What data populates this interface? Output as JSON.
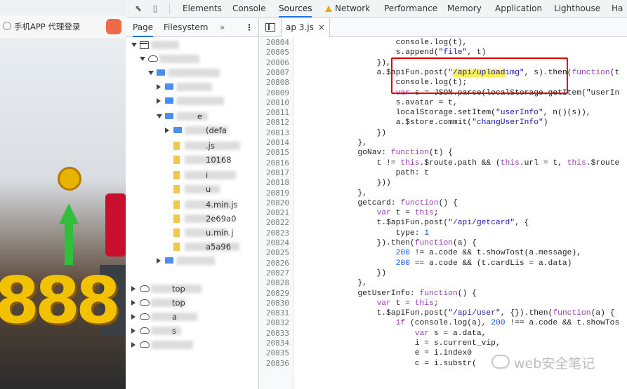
{
  "left_page": {
    "header_text": "手机APP 代理登录"
  },
  "devtools": {
    "tabs": [
      "Elements",
      "Console",
      "Sources",
      "Network",
      "Performance",
      "Memory",
      "Application",
      "Lighthouse",
      "Ha"
    ],
    "active_tab": "Sources",
    "navigator": {
      "subtabs": [
        "Page",
        "Filesystem"
      ],
      "more_label": "»",
      "menu_label": "⋮",
      "tree": [
        {
          "label": "",
          "icon": "window-icon"
        },
        {
          "label": "",
          "icon": "cloud-icon"
        },
        {
          "label": "",
          "icon": "folder-icon"
        },
        {
          "label": "",
          "icon": "folder-icon"
        },
        {
          "label": "",
          "icon": "folder-icon"
        },
        {
          "label": "e",
          "icon": "folder-icon"
        },
        {
          "label": "(defa",
          "icon": "folder-icon"
        },
        {
          "label": ".js",
          "icon": "file-icon"
        },
        {
          "label": "10168",
          "icon": "file-icon"
        },
        {
          "label": "i",
          "icon": "file-icon"
        },
        {
          "label": "u",
          "icon": "file-icon"
        },
        {
          "label": "4.min.js",
          "icon": "file-icon"
        },
        {
          "label": "2e69a0",
          "icon": "file-icon"
        },
        {
          "label": "u.min.j",
          "icon": "file-icon"
        },
        {
          "label": "a5a96",
          "icon": "file-icon"
        },
        {
          "label": "",
          "icon": "folder-icon"
        },
        {
          "label": "top",
          "icon": "cloud-icon"
        },
        {
          "label": "top",
          "icon": "cloud-icon"
        },
        {
          "label": "a",
          "icon": "cloud-icon"
        },
        {
          "label": "s",
          "icon": "cloud-icon"
        },
        {
          "label": "",
          "icon": "cloud-icon"
        }
      ]
    },
    "editor": {
      "file_tab": "ap                    3.js",
      "close_label": "×",
      "lines": [
        {
          "n": "20804",
          "code": "                    console.log(t),"
        },
        {
          "n": "20805",
          "code": "                    s.append(\"file\", t)"
        },
        {
          "n": "20806",
          "code": "                }),"
        },
        {
          "n": "20807",
          "code": "                a.$apiFun.post(\"/api/uploadimg\", s).then(function(t"
        },
        {
          "n": "20808",
          "code": "                    console.log(t);"
        },
        {
          "n": "20809",
          "code": "                    var s = JSON.parse(localStorage.getItem(\"userIn"
        },
        {
          "n": "20810",
          "code": "                    s.avatar = t,"
        },
        {
          "n": "20811",
          "code": "                    localStorage.setItem(\"userInfo\", n()(s)),"
        },
        {
          "n": "20812",
          "code": "                    a.$store.commit(\"changUserInfo\")"
        },
        {
          "n": "20813",
          "code": "                })"
        },
        {
          "n": "20814",
          "code": "            },"
        },
        {
          "n": "20815",
          "code": "            goNav: function(t) {"
        },
        {
          "n": "20816",
          "code": "                t != this.$route.path && (this.url = t, this.$route"
        },
        {
          "n": "20817",
          "code": "                    path: t"
        },
        {
          "n": "20818",
          "code": "                }))"
        },
        {
          "n": "20819",
          "code": "            },"
        },
        {
          "n": "20820",
          "code": "            getcard: function() {"
        },
        {
          "n": "20821",
          "code": "                var t = this;"
        },
        {
          "n": "20822",
          "code": "                t.$apiFun.post(\"/api/getcard\", {"
        },
        {
          "n": "20823",
          "code": "                    type: 1"
        },
        {
          "n": "20824",
          "code": "                }).then(function(a) {"
        },
        {
          "n": "20825",
          "code": "                    200 != a.code && t.showTost(a.message),"
        },
        {
          "n": "20826",
          "code": "                    200 == a.code && (t.cardLis = a.data)"
        },
        {
          "n": "20827",
          "code": "                })"
        },
        {
          "n": "20828",
          "code": "            },"
        },
        {
          "n": "20829",
          "code": "            getUserInfo: function() {"
        },
        {
          "n": "20830",
          "code": "                var t = this;"
        },
        {
          "n": "20831",
          "code": "                t.$apiFun.post(\"/api/user\", {}).then(function(a) {"
        },
        {
          "n": "20832",
          "code": "                    if (console.log(a), 200 !== a.code && t.showTos"
        },
        {
          "n": "20833",
          "code": "                        var s = a.data,"
        },
        {
          "n": "20834",
          "code": "                        i = s.current_vip,"
        },
        {
          "n": "20835",
          "code": "                        e = i.index0"
        },
        {
          "n": "20836",
          "code": "                        c = i.substr("
        }
      ]
    }
  },
  "watermark": {
    "text": "web安全笔记"
  },
  "colors": {
    "highlight_box": "#e00000",
    "code_highlight": "#f9f35e",
    "active_tab_underline": "#1a73e8"
  }
}
